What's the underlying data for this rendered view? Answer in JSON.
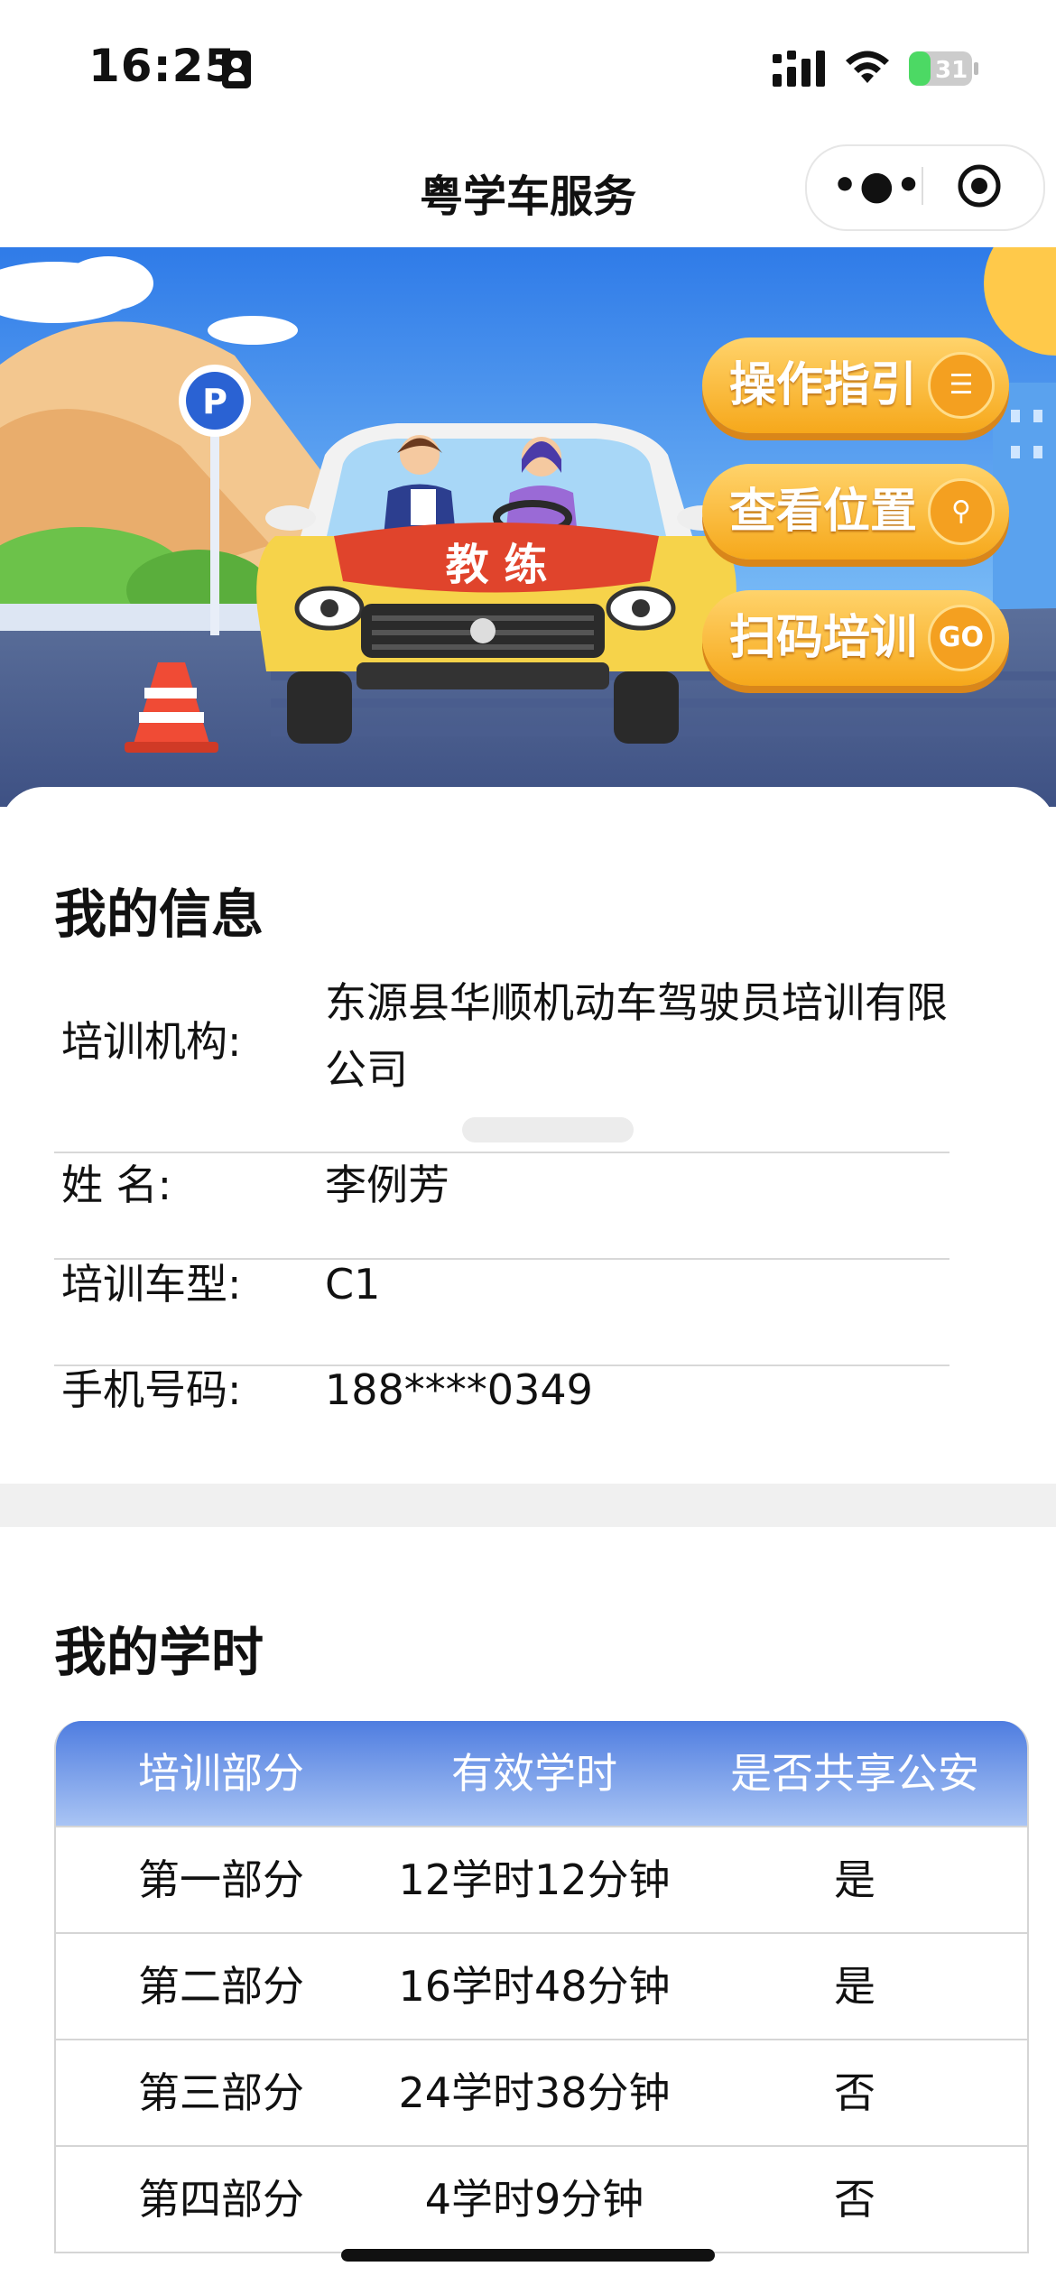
{
  "status_bar": {
    "time": "16:25",
    "battery": "31"
  },
  "nav": {
    "title": "粤学车服务",
    "more_icon": "more-dots-icon",
    "close_icon": "target-circle-icon"
  },
  "banner": {
    "car_label": "教 练",
    "parking_sign": "P",
    "buttons": [
      {
        "label": "操作指引",
        "icon": "document-icon"
      },
      {
        "label": "查看位置",
        "icon": "location-pin-icon"
      },
      {
        "label": "扫码培训",
        "icon_text": "GO"
      }
    ]
  },
  "my_info": {
    "title": "我的信息",
    "fields": [
      {
        "label": "培训机构:",
        "value": "东源县华顺机动车驾驶员培训有限公司"
      },
      {
        "label": "姓  名:",
        "value": "李例芳"
      },
      {
        "label": "培训车型:",
        "value": "C1"
      },
      {
        "label": "手机号码:",
        "value": "188****0349"
      }
    ]
  },
  "my_hours": {
    "title": "我的学时",
    "headers": [
      "培训部分",
      "有效学时",
      "是否共享公安"
    ],
    "rows": [
      [
        "第一部分",
        "12学时12分钟",
        "是"
      ],
      [
        "第二部分",
        "16学时48分钟",
        "是"
      ],
      [
        "第三部分",
        "24学时38分钟",
        "否"
      ],
      [
        "第四部分",
        "4学时9分钟",
        "否"
      ]
    ]
  },
  "colors": {
    "table_header_top": "#4f7de0",
    "table_header_bottom": "#a9c4f4",
    "banner_button": "#f6a81b",
    "car_body": "#e0442c"
  }
}
